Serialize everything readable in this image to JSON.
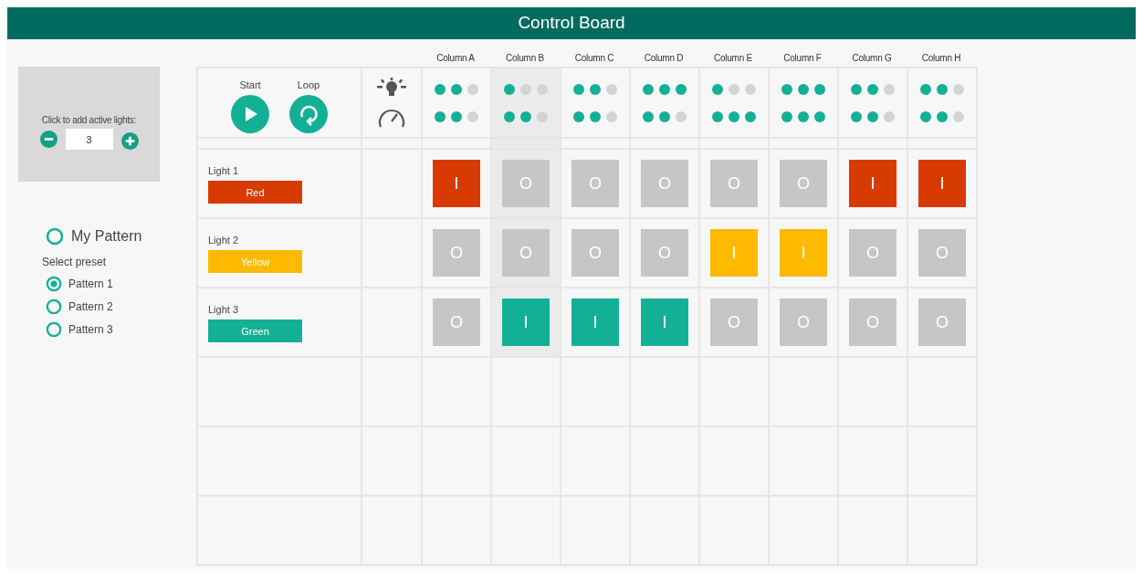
{
  "title": "Control Board",
  "active_lights": {
    "label": "Click to add active lights:",
    "value": "3"
  },
  "my_pattern": {
    "label": "My Pattern",
    "selected": false
  },
  "preset": {
    "label": "Select preset",
    "options": [
      {
        "label": "Pattern 1",
        "selected": true
      },
      {
        "label": "Pattern 2",
        "selected": false
      },
      {
        "label": "Pattern 3",
        "selected": false
      }
    ]
  },
  "controls": [
    {
      "kind": "play",
      "label": "Start"
    },
    {
      "kind": "loop",
      "label": "Loop"
    }
  ],
  "columns": [
    {
      "label": "Column A",
      "selected": false,
      "brightness": {
        "stars": 2
      },
      "speed": {
        "stars": 2
      }
    },
    {
      "label": "Column B",
      "selected": true,
      "brightness": {
        "stars": 1
      },
      "speed": {
        "stars": 2
      }
    },
    {
      "label": "Column C",
      "selected": false,
      "brightness": {
        "stars": 2
      },
      "speed": {
        "stars": 2
      }
    },
    {
      "label": "Column D",
      "selected": false,
      "brightness": {
        "stars": 3
      },
      "speed": {
        "stars": 2
      }
    },
    {
      "label": "Column E",
      "selected": false,
      "brightness": {
        "stars": 1
      },
      "speed": {
        "stars": 3
      }
    },
    {
      "label": "Column F",
      "selected": false,
      "brightness": {
        "stars": 3
      },
      "speed": {
        "stars": 3
      }
    },
    {
      "label": "Column G",
      "selected": false,
      "brightness": {
        "stars": 2
      },
      "speed": {
        "stars": 2
      }
    },
    {
      "label": "Column H",
      "selected": false,
      "brightness": {
        "stars": 2
      },
      "speed": {
        "stars": 2
      }
    }
  ],
  "lights": [
    {
      "name": "Light 1",
      "color_label": "Red",
      "color": "#d83b01",
      "cells": [
        {
          "text": "I",
          "on": true
        },
        {
          "text": "O",
          "on": false
        },
        {
          "text": "O",
          "on": false
        },
        {
          "text": "O",
          "on": false
        },
        {
          "text": "O",
          "on": false
        },
        {
          "text": "O",
          "on": false
        },
        {
          "text": "I",
          "on": true
        },
        {
          "text": "I",
          "on": true
        }
      ]
    },
    {
      "name": "Light 2",
      "color_label": "Yellow",
      "color": "#ffb900",
      "cells": [
        {
          "text": "O",
          "on": false
        },
        {
          "text": "O",
          "on": false
        },
        {
          "text": "O",
          "on": false
        },
        {
          "text": "O",
          "on": false
        },
        {
          "text": "I",
          "on": true
        },
        {
          "text": "I",
          "on": true
        },
        {
          "text": "O",
          "on": false
        },
        {
          "text": "O",
          "on": false
        }
      ]
    },
    {
      "name": "Light 3",
      "color_label": "Green",
      "color": "#14b096",
      "cells": [
        {
          "text": "O",
          "on": false
        },
        {
          "text": "I",
          "on": true
        },
        {
          "text": "I",
          "on": true
        },
        {
          "text": "I",
          "on": true
        },
        {
          "text": "O",
          "on": false
        },
        {
          "text": "O",
          "on": false
        },
        {
          "text": "O",
          "on": false
        },
        {
          "text": "O",
          "on": false
        }
      ]
    }
  ]
}
